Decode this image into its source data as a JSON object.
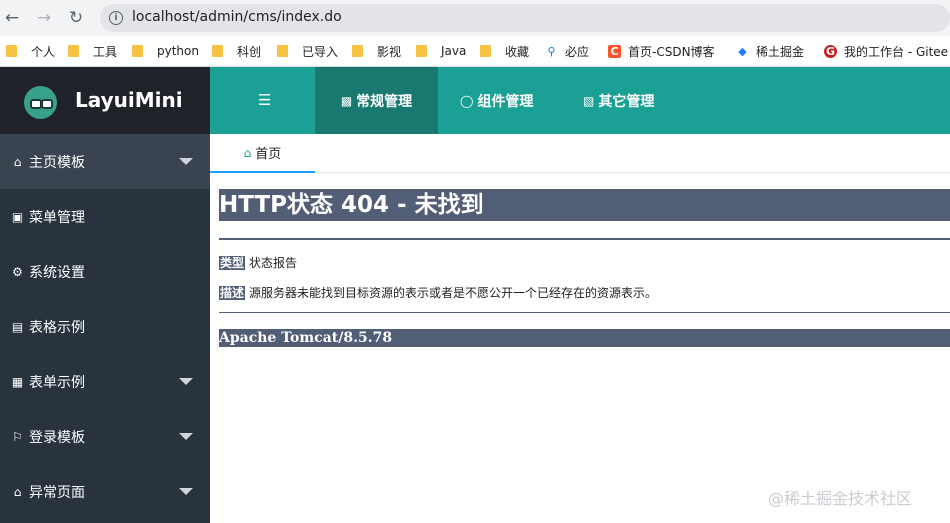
{
  "browser": {
    "back_icon": "arrow-left",
    "forward_icon": "arrow-right",
    "reload_icon": "reload",
    "url": "localhost/admin/cms/index.do",
    "bookmarks": [
      {
        "label": "个人",
        "icon": "folder"
      },
      {
        "label": "工具",
        "icon": "folder"
      },
      {
        "label": "python",
        "icon": "folder"
      },
      {
        "label": "科创",
        "icon": "folder"
      },
      {
        "label": "已导入",
        "icon": "folder"
      },
      {
        "label": "影视",
        "icon": "folder"
      },
      {
        "label": "Java",
        "icon": "folder"
      },
      {
        "label": "收藏",
        "icon": "folder"
      },
      {
        "label": "必应",
        "icon": "search"
      },
      {
        "label": "首页-CSDN博客",
        "icon": "csdn"
      },
      {
        "label": "稀土掘金",
        "icon": "juejin"
      },
      {
        "label": "我的工作台 - Gitee",
        "icon": "gitee"
      }
    ]
  },
  "app": {
    "logo_text": "LayuiMini",
    "sidebar": {
      "items": [
        {
          "label": "主页模板",
          "icon": "home",
          "has_caret": true,
          "active": true
        },
        {
          "label": "菜单管理",
          "icon": "window",
          "has_caret": false
        },
        {
          "label": "系统设置",
          "icon": "gears",
          "has_caret": false
        },
        {
          "label": "表格示例",
          "icon": "file",
          "has_caret": false
        },
        {
          "label": "表单示例",
          "icon": "calendar",
          "has_caret": true
        },
        {
          "label": "登录模板",
          "icon": "flag",
          "has_caret": true
        },
        {
          "label": "异常页面",
          "icon": "home",
          "has_caret": true
        }
      ]
    },
    "topbar": {
      "toggle_icon": "indent",
      "tabs": [
        {
          "label": "常规管理",
          "icon": "address-card",
          "active": true
        },
        {
          "label": "组件管理",
          "icon": "snowflake",
          "active": false
        },
        {
          "label": "其它管理",
          "icon": "slideshare",
          "active": false
        }
      ]
    },
    "page_tabs": [
      {
        "label": "首页",
        "icon": "home"
      }
    ]
  },
  "error_page": {
    "title": "HTTP状态 404 - 未找到",
    "type_label": "类型",
    "type_value": "状态报告",
    "desc_label": "描述",
    "desc_value": "源服务器未能找到目标资源的表示或者是不愿公开一个已经存在的资源表示。",
    "server": "Apache Tomcat/8.5.78"
  },
  "watermark": "@稀土掘金技术社区",
  "colors": {
    "sidebar_bg": "#28333e",
    "logo_bg": "#20222a",
    "topbar_bg": "#1aa094",
    "topbar_active": "#197971",
    "tomcat_bar": "#525d76"
  }
}
